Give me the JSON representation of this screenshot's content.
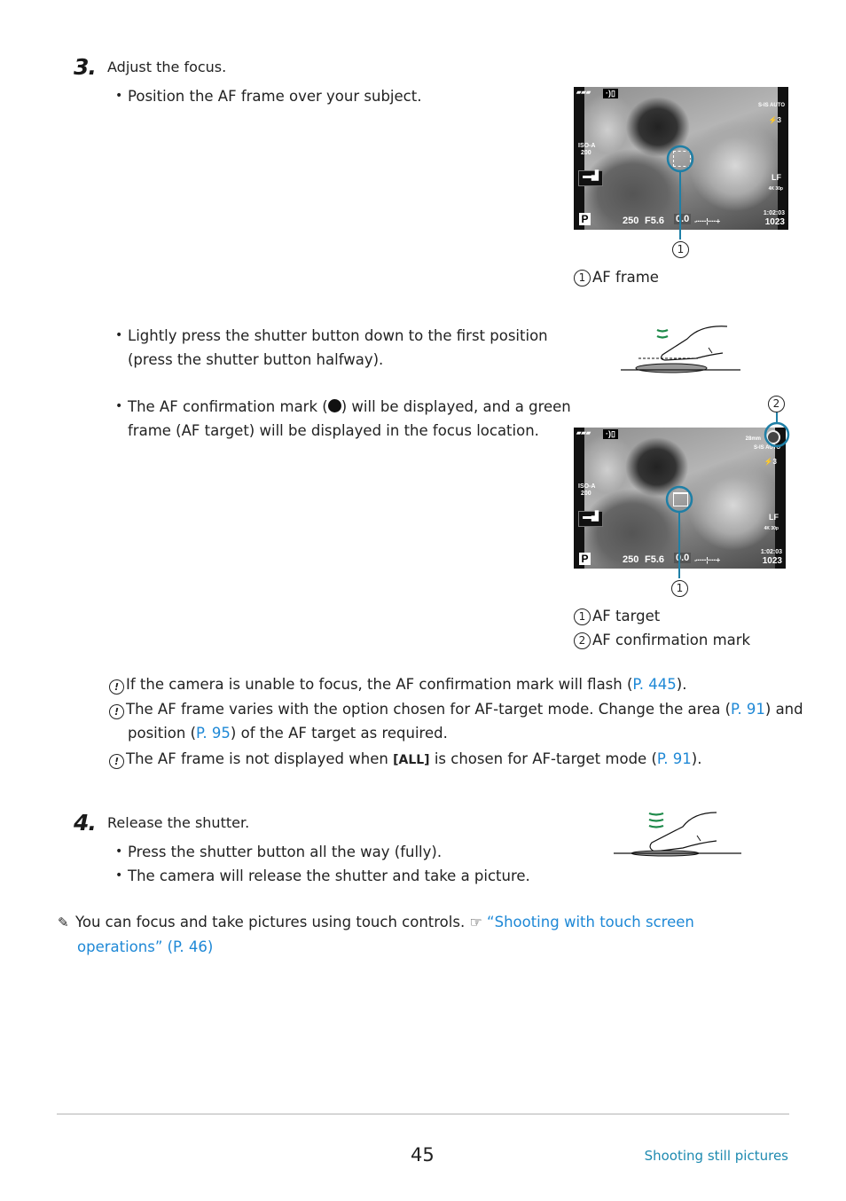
{
  "step3": {
    "number": "3.",
    "title": "Adjust the focus.",
    "bullets": [
      "Position the AF frame over your subject.",
      "Lightly press the shutter button down to the first position (press the shutter button halfway).",
      "The AF confirmation mark (",
      ") will be displayed, and a green frame (AF target) will be displayed in the focus location."
    ],
    "figure1": {
      "callout_number": "1",
      "legend": [
        {
          "num": "1",
          "label": "AF frame"
        }
      ]
    },
    "figure2": {
      "callout_numbers": [
        "1",
        "2"
      ],
      "legend": [
        {
          "num": "1",
          "label": "AF target"
        },
        {
          "num": "2",
          "label": "AF confirmation mark"
        }
      ]
    },
    "notes": [
      {
        "text": "If the camera is unable to focus, the AF confirmation mark will flash (",
        "link": "P. 445",
        "after": ")."
      },
      {
        "text": "The AF frame varies with the option chosen for AF-target mode. Change the area (",
        "link": "P. 91",
        "mid": ") and position (",
        "link2": "P. 95",
        "after": ") of the AF target as required."
      },
      {
        "text": "The AF frame is not displayed when ",
        "mode_icon": "[ALL]",
        "mid": " is chosen for AF-target mode (",
        "link": "P. 91",
        "after": ")."
      }
    ]
  },
  "camera_display": {
    "mode": "P",
    "shutter": "250",
    "aperture": "F5.6",
    "exposure_comp": "0.0",
    "iso_label": "ISO-A",
    "iso_value": "200",
    "record_time": "1:02:03",
    "shots_remaining": "1023",
    "stabilizer": "S-IS AUTO",
    "quality": "LF",
    "video_mode": "4K 30p",
    "zoom_label": "28mm"
  },
  "step4": {
    "number": "4.",
    "title": "Release the shutter.",
    "bullets": [
      "Press the shutter button all the way (fully).",
      "The camera will release the shutter and take a picture."
    ]
  },
  "tip": {
    "text": "You can focus and take pictures using touch controls.",
    "link": "“Shooting with touch screen operations” (P. 46)"
  },
  "footer": {
    "page_number": "45",
    "section": "Shooting still pictures"
  },
  "colors": {
    "link": "#1e88d6",
    "callout": "#1f7fa6",
    "green_arrows": "#1e8a4a"
  }
}
